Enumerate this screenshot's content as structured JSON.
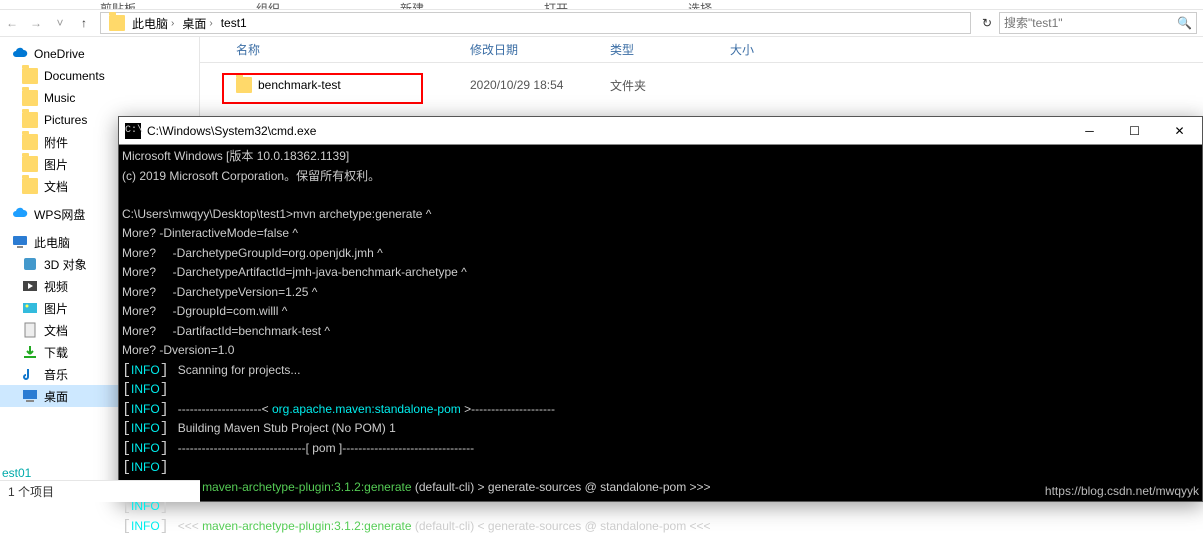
{
  "menubar": [
    "剪贴板",
    "组织",
    "新建",
    "打开",
    "选择"
  ],
  "breadcrumb": {
    "parts": [
      "此电脑",
      "桌面",
      "test1"
    ]
  },
  "search": {
    "placeholder": "搜索\"test1\""
  },
  "sidebar": {
    "onedrive": "OneDrive",
    "quick": [
      "Documents",
      "Music",
      "Pictures",
      "附件",
      "图片",
      "文档"
    ],
    "wps": "WPS网盘",
    "pc": "此电脑",
    "pclist": [
      "3D 对象",
      "视频",
      "图片",
      "文档",
      "下载",
      "音乐",
      "桌面"
    ]
  },
  "columns": {
    "name": "名称",
    "date": "修改日期",
    "type": "类型",
    "size": "大小"
  },
  "rows": [
    {
      "name": "benchmark-test",
      "date": "2020/10/29 18:54",
      "type": "文件夹"
    }
  ],
  "status": "1 个项目",
  "footer": "est01",
  "cmd": {
    "title": "C:\\Windows\\System32\\cmd.exe",
    "line1": "Microsoft Windows [版本 10.0.18362.1139]",
    "line2": "(c) 2019 Microsoft Corporation。保留所有权利。",
    "l3": "C:\\Users\\mwqyy\\Desktop\\test1>mvn archetype:generate ^",
    "l4": "More? -DinteractiveMode=false ^",
    "l5": "More?     -DarchetypeGroupId=org.openjdk.jmh ^",
    "l6": "More?     -DarchetypeArtifactId=jmh-java-benchmark-archetype ^",
    "l7": "More?     -DarchetypeVersion=1.25 ^",
    "l8": "More?     -DgroupId=com.willl ^",
    "l9": "More?     -DartifactId=benchmark-test ^",
    "l10": "More? -Dversion=1.0",
    "info": "INFO",
    "scan": "Scanning for projects...",
    "dash1": "---------------------< ",
    "pom": "org.apache.maven:standalone-pom",
    "dash1b": " >---------------------",
    "build": "Building Maven Stub Project (No POM) 1",
    "dash2": "--------------------------------[ pom ]---------------------------------",
    "arrow1": ">>> ",
    "plugin": "maven-archetype-plugin:3.1.2:generate",
    "tail1": " (default-cli) > generate-sources @ standalone-pom >>>",
    "arrow2": "<<< ",
    "tail2": " (default-cli) < generate-sources @ standalone-pom <<<"
  },
  "watermark": "https://blog.csdn.net/mwqyyk"
}
